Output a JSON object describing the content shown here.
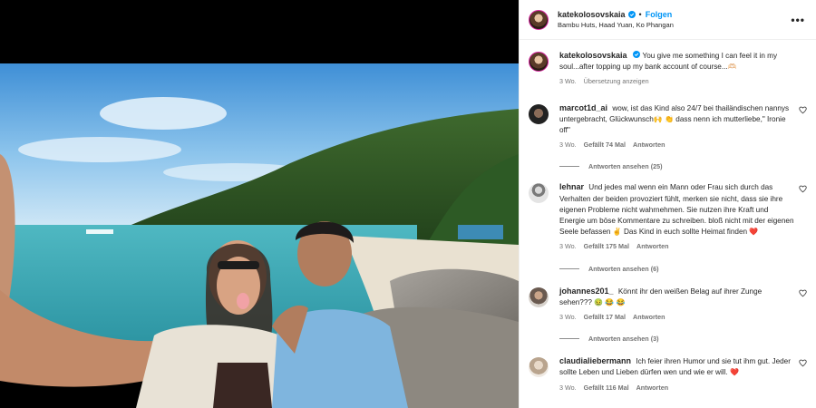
{
  "post": {
    "username": "katekolosovskaia",
    "follow_label": "Folgen",
    "location": "Bambu Huts, Haad Yuan, Ko Phangan",
    "more_label": "•••",
    "caption": {
      "username": "katekolosovskaia",
      "text": "You give me something I can feel it in my soul...after topping up my bank account of course...",
      "emoji": "🫶🏻",
      "time": "3 Wo.",
      "translate_label": "Übersetzung anzeigen"
    }
  },
  "comments": [
    {
      "username": "marcot1d_ai",
      "text": "wow, ist das Kind also 24/7 bei thailändischen nannys untergebracht, Glückwunsch",
      "emoji1": "🙌",
      "mid": "dass nenn ich mutterliebe,\" Ironie off\"",
      "emoji2": "👏",
      "time": "3 Wo.",
      "likes": "Gefällt 74 Mal",
      "reply": "Antworten",
      "view_replies": "Antworten ansehen (25)"
    },
    {
      "username": "lehnar",
      "text": "Und jedes mal wenn ein Mann oder Frau sich durch das Verhalten der beiden provoziert fühlt, merken sie nicht, dass sie ihre eigenen Probleme nicht wahrnehmen. Sie nutzen ihre Kraft und Energie um böse Kommentare zu schreiben. bloß nicht mit der eigenen Seele befassen",
      "emoji1": "✌️",
      "tail": "Das Kind in euch sollte Heimat finden",
      "emoji2": "❤️",
      "time": "3 Wo.",
      "likes": "Gefällt 175 Mal",
      "reply": "Antworten",
      "view_replies": "Antworten ansehen (6)"
    },
    {
      "username": "johannes201_",
      "text": "Könnt ihr den weißen Belag auf ihrer Zunge sehen???",
      "emoji": "🤢 😂 😂",
      "time": "3 Wo.",
      "likes": "Gefällt 17 Mal",
      "reply": "Antworten",
      "view_replies": "Antworten ansehen (3)"
    },
    {
      "username": "claudialiebermann",
      "text": "Ich feier ihren Humor und sie tut ihm gut. Jeder sollte Leben und Lieben dürfen wen und wie er will.",
      "emoji": "❤️",
      "time": "3 Wo.",
      "likes": "Gefällt 116 Mal",
      "reply": "Antworten"
    }
  ],
  "colors": {
    "link_blue": "#0095f6",
    "verified_blue": "#0095f6",
    "meta_gray": "#737373",
    "like_red": "#ed4956"
  },
  "icons": {
    "verified": "verified-badge-icon",
    "heart": "heart-outline-icon",
    "more": "more-options-icon"
  }
}
